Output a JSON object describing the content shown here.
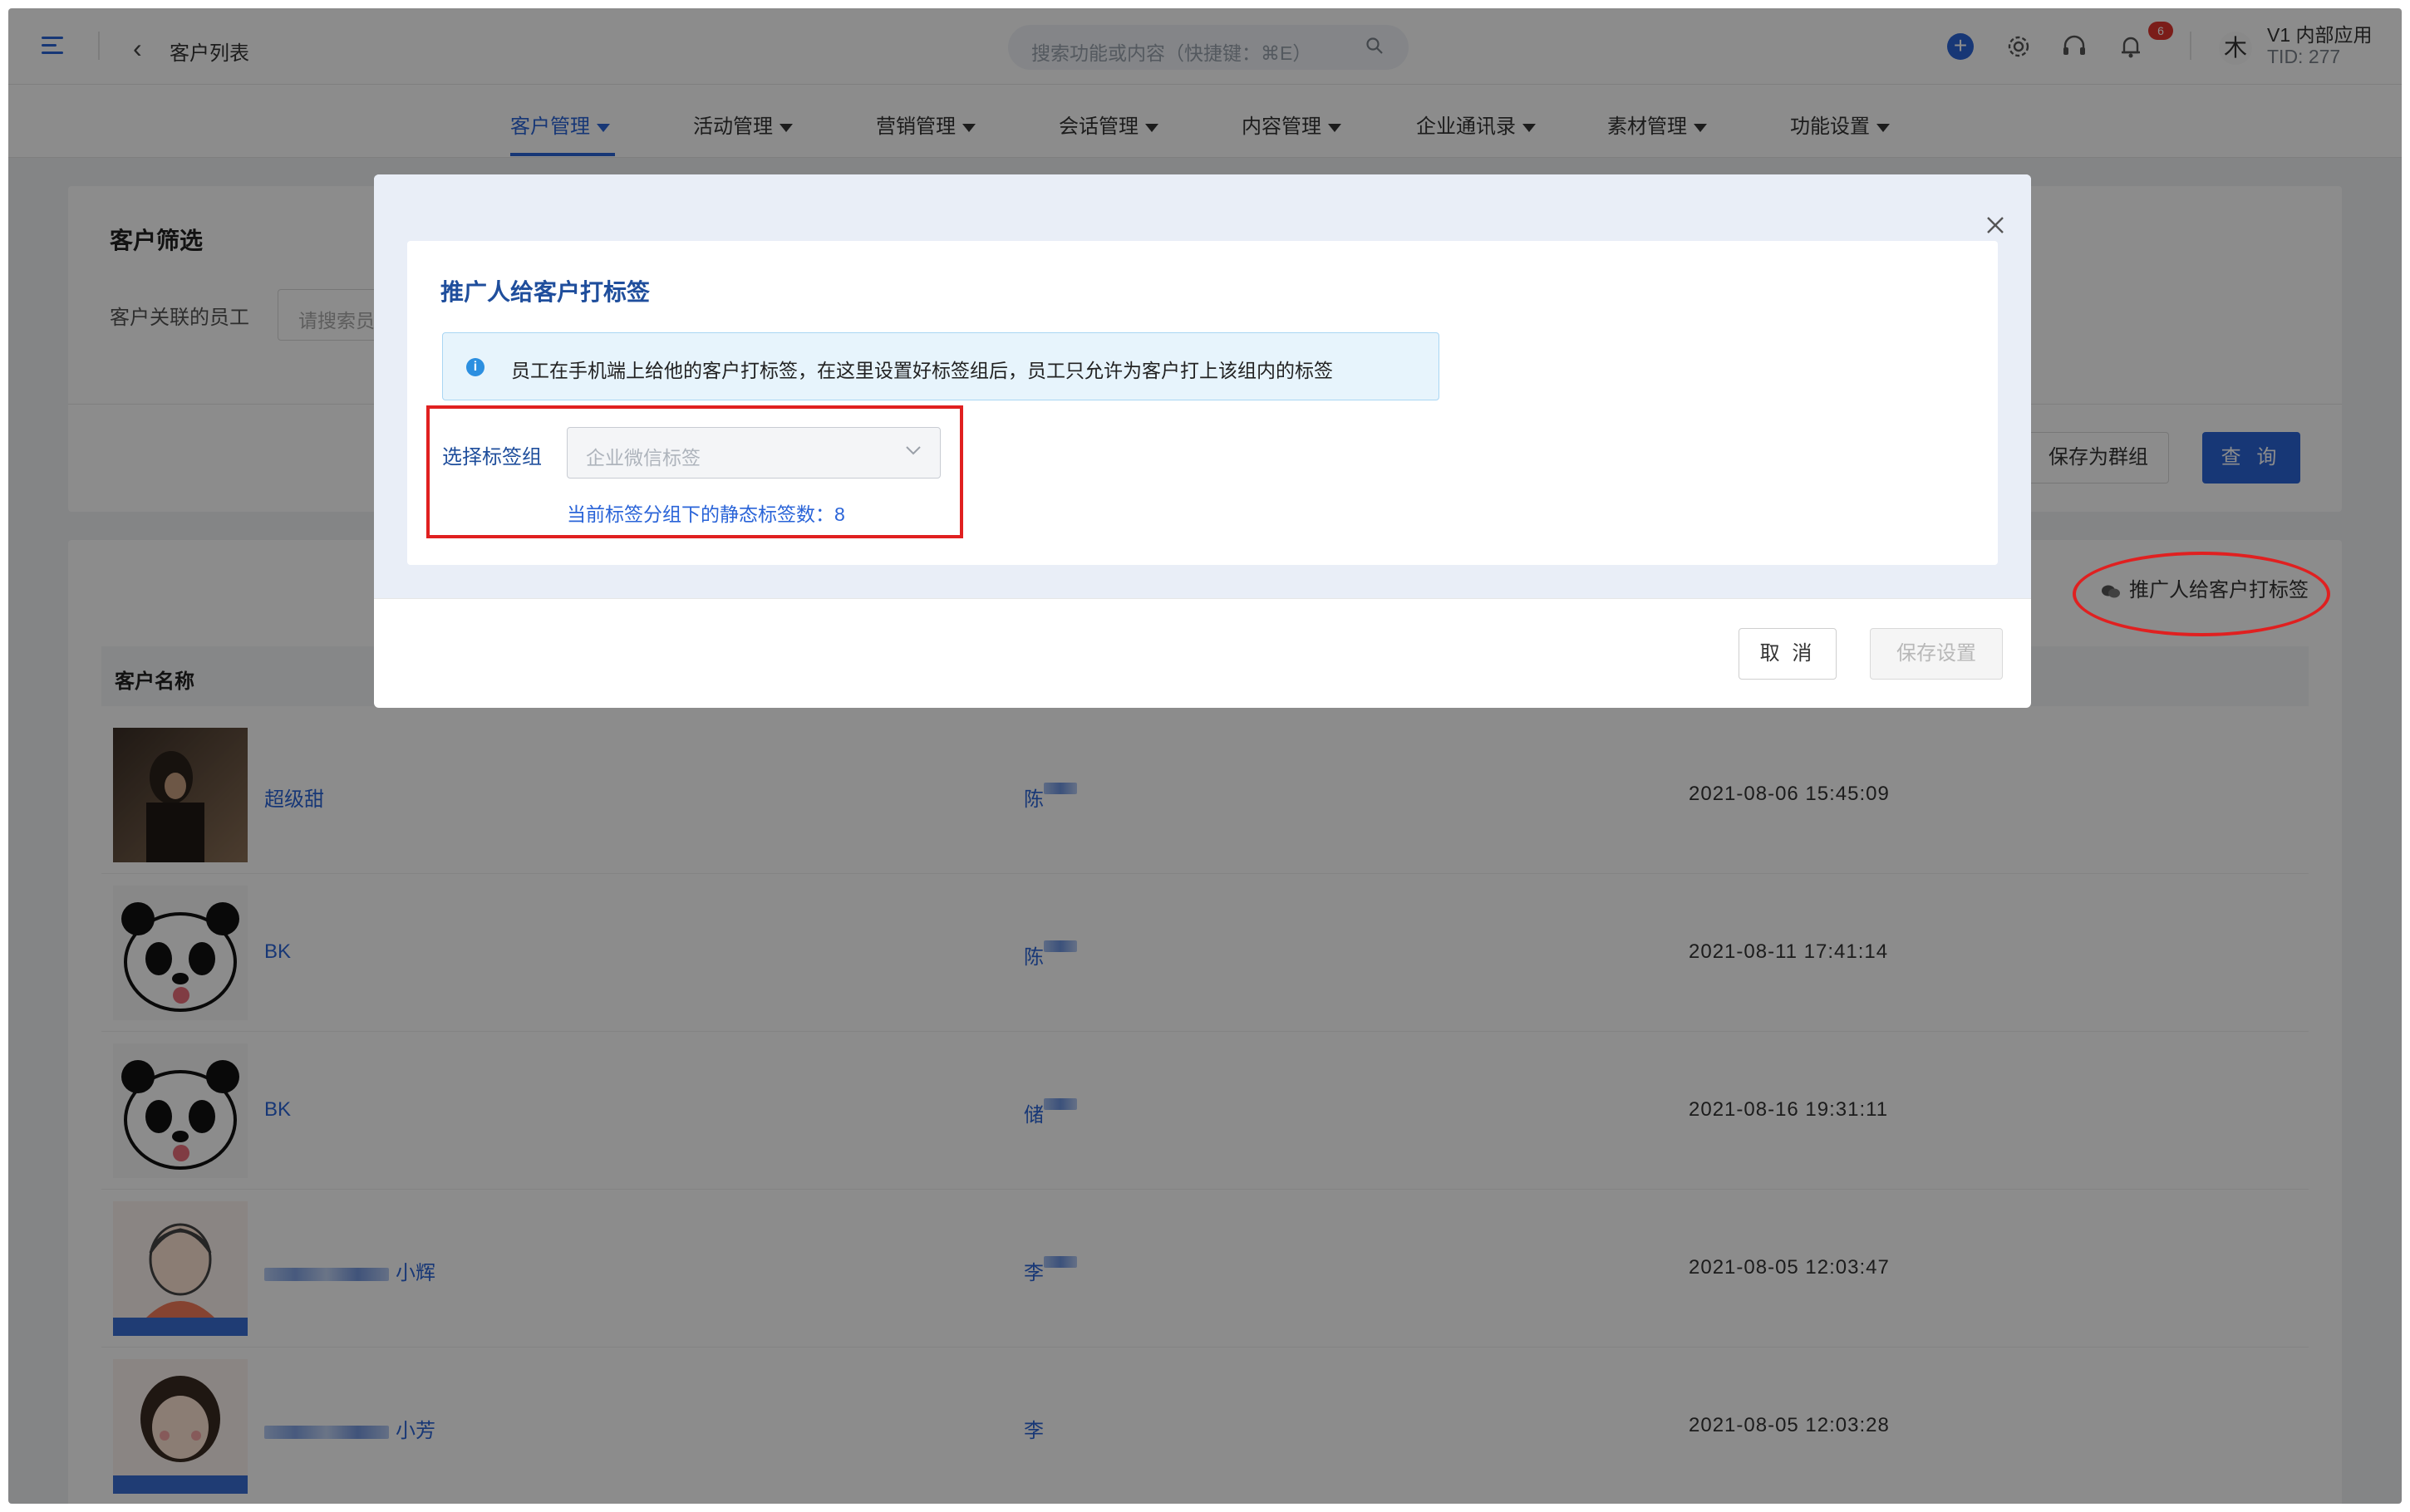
{
  "header": {
    "breadcrumb": "客户列表",
    "search_placeholder": "搜索功能或内容（快捷键：⌘E）",
    "notification_count": "6",
    "avatar_letter": "木",
    "app_name": "V1 内部应用",
    "tid": "TID: 277"
  },
  "nav": {
    "items": [
      {
        "label": "客户管理",
        "active": true
      },
      {
        "label": "活动管理"
      },
      {
        "label": "营销管理"
      },
      {
        "label": "会话管理"
      },
      {
        "label": "内容管理"
      },
      {
        "label": "企业通讯录"
      },
      {
        "label": "素材管理"
      },
      {
        "label": "功能设置"
      }
    ]
  },
  "filter": {
    "title": "客户筛选",
    "employee_label": "客户关联的员工",
    "employee_placeholder": "请搜索员",
    "save_group_label": "保存为群组",
    "query_label": "查 询"
  },
  "list": {
    "tag_action_label": "推广人给客户打标签",
    "column_customer": "客户名称",
    "rows": [
      {
        "name": "超级甜",
        "staff": "陈",
        "time": "2021-08-06 15:45:09",
        "blurred": false
      },
      {
        "name": "BK",
        "staff": "陈",
        "time": "2021-08-11 17:41:14",
        "blurred": false
      },
      {
        "name": "BK",
        "staff": "储",
        "time": "2021-08-16 19:31:11",
        "blurred": false
      },
      {
        "name": "小辉",
        "staff": "李",
        "time": "2021-08-05 12:03:47",
        "blurred": true
      },
      {
        "name": "小芳",
        "staff": "李",
        "time": "2021-08-05 12:03:28",
        "blurred": true
      }
    ]
  },
  "dialog": {
    "title": "推广人给客户打标签",
    "info_text": "员工在手机端上给他的客户打标签，在这里设置好标签组后，员工只允许为客户打上该组内的标签",
    "select_label": "选择标签组",
    "select_placeholder": "企业微信标签",
    "count_text": "当前标签分组下的静态标签数：8",
    "cancel_label": "取 消",
    "save_label": "保存设置"
  },
  "colors": {
    "primary": "#2a64d8",
    "annotation_red": "#e02020",
    "info_bg": "#e7f4fc"
  }
}
